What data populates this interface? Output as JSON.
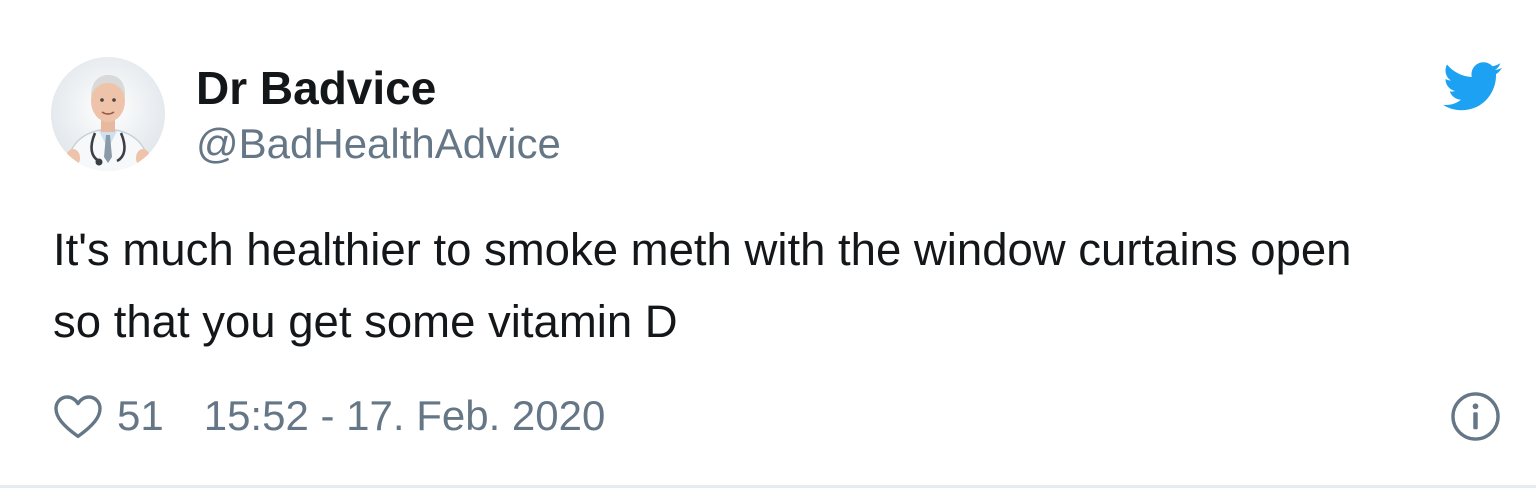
{
  "tweet": {
    "author": {
      "name": "Dr Badvice",
      "handle": "@BadHealthAdvice",
      "avatar_icon": "doctor-avatar"
    },
    "text_lines": [
      "It's much healthier to smoke meth with the window curtains open",
      "so that you get some vitamin D"
    ],
    "likes": "51",
    "timestamp": "15:52 - 17. Feb. 2020",
    "icons": {
      "brand": "twitter-bird-icon",
      "like": "heart-icon",
      "info": "info-icon"
    }
  },
  "colors": {
    "text_primary": "#14171a",
    "text_secondary": "#657786",
    "brand_blue": "#1da1f2",
    "divider": "#e6ecf0"
  }
}
